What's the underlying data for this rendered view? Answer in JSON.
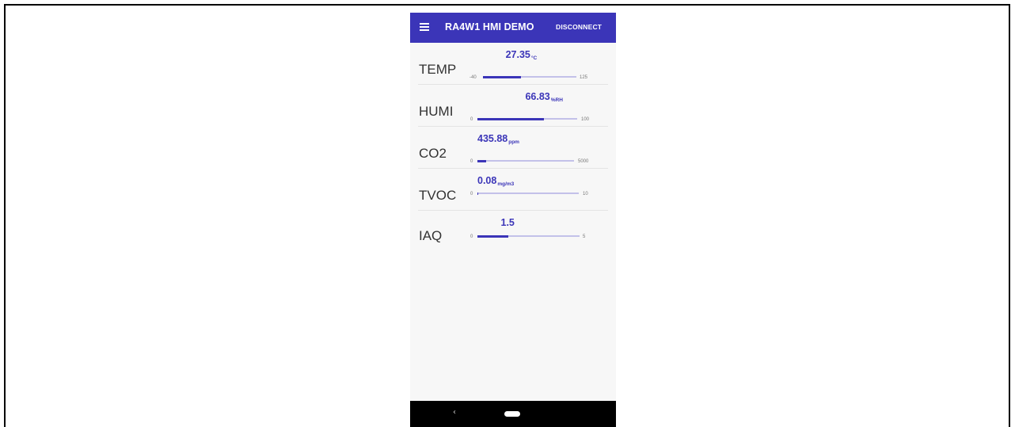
{
  "app": {
    "title": "RA4W1 HMI DEMO",
    "disconnect_label": "DISCONNECT",
    "accent_color": "#3b35b8",
    "track_color": "#c3c1e9"
  },
  "icons": {
    "menu": "menu-icon",
    "back": "back-icon",
    "home": "home-pill-icon",
    "back_glyph": "‹"
  },
  "sensors": [
    {
      "label": "TEMP",
      "value": "27.35",
      "unit": "°C",
      "min": "-40",
      "max": "125",
      "fraction": 0.41
    },
    {
      "label": "HUMI",
      "value": "66.83",
      "unit": "%RH",
      "min": "0",
      "max": "100",
      "fraction": 0.668
    },
    {
      "label": "CO2",
      "value": "435.88",
      "unit": "ppm",
      "min": "0",
      "max": "5000",
      "fraction": 0.087
    },
    {
      "label": "TVOC",
      "value": "0.08",
      "unit": "mg/m3",
      "min": "0",
      "max": "10",
      "fraction": 0.008
    },
    {
      "label": "IAQ",
      "value": "1.5",
      "unit": "",
      "min": "0",
      "max": "5",
      "fraction": 0.3
    }
  ]
}
